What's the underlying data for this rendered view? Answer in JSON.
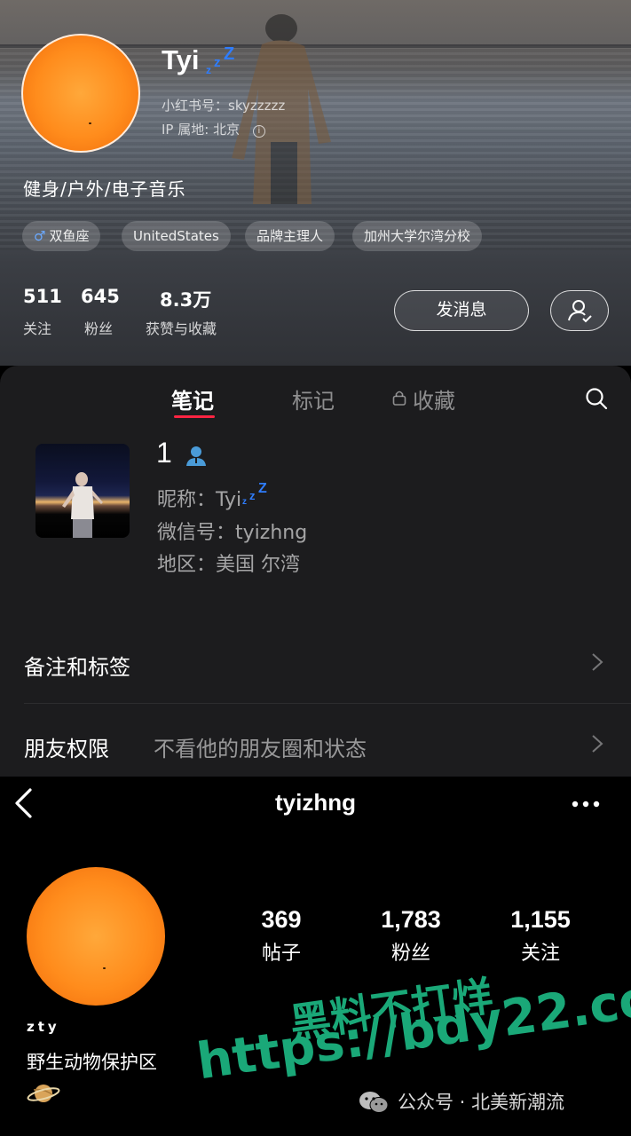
{
  "xhs": {
    "name": "Tyi",
    "zzz": [
      "z",
      "z",
      "Z"
    ],
    "id_label": "小红书号：",
    "id_value": "skyzzzzz",
    "ip_label": "IP 属地: ",
    "ip_value": "北京",
    "bio": "健身/户外/电子音乐",
    "tags": [
      "双鱼座",
      "UnitedStates",
      "品牌主理人",
      "加州大学尔湾分校"
    ],
    "stats": [
      {
        "num": "511",
        "label": "关注"
      },
      {
        "num": "645",
        "label": "粉丝"
      },
      {
        "num": "8.3万",
        "label": "获赞与收藏"
      }
    ],
    "message_button": "发消息",
    "tabs": [
      "笔记",
      "标记",
      "收藏"
    ]
  },
  "wechat": {
    "remark": "1",
    "nickname_label": "昵称：",
    "nickname": "Tyi",
    "wechat_id_label": "微信号：",
    "wechat_id": "tyizhng",
    "region_label": "地区：",
    "region": "美国 尔湾",
    "remarks_tags_label": "备注和标签",
    "permissions_label": "朋友权限",
    "permissions_value": "不看他的朋友圈和状态"
  },
  "instagram": {
    "username": "tyizhng",
    "stats": [
      {
        "num": "369",
        "label": "帖子"
      },
      {
        "num": "1,783",
        "label": "粉丝"
      },
      {
        "num": "1,155",
        "label": "关注"
      }
    ],
    "full_name": "zty",
    "bio": "野生动物保护区"
  },
  "overlay": {
    "watermark_cn": "黑料不打烊",
    "watermark_url": "https://bdy22.co",
    "credit": "公众号 · 北美新潮流"
  },
  "colors": {
    "xhs_accent": "#ff2442",
    "zzz_blue": "#2f7dff",
    "watermark_green": "#1aa878"
  }
}
